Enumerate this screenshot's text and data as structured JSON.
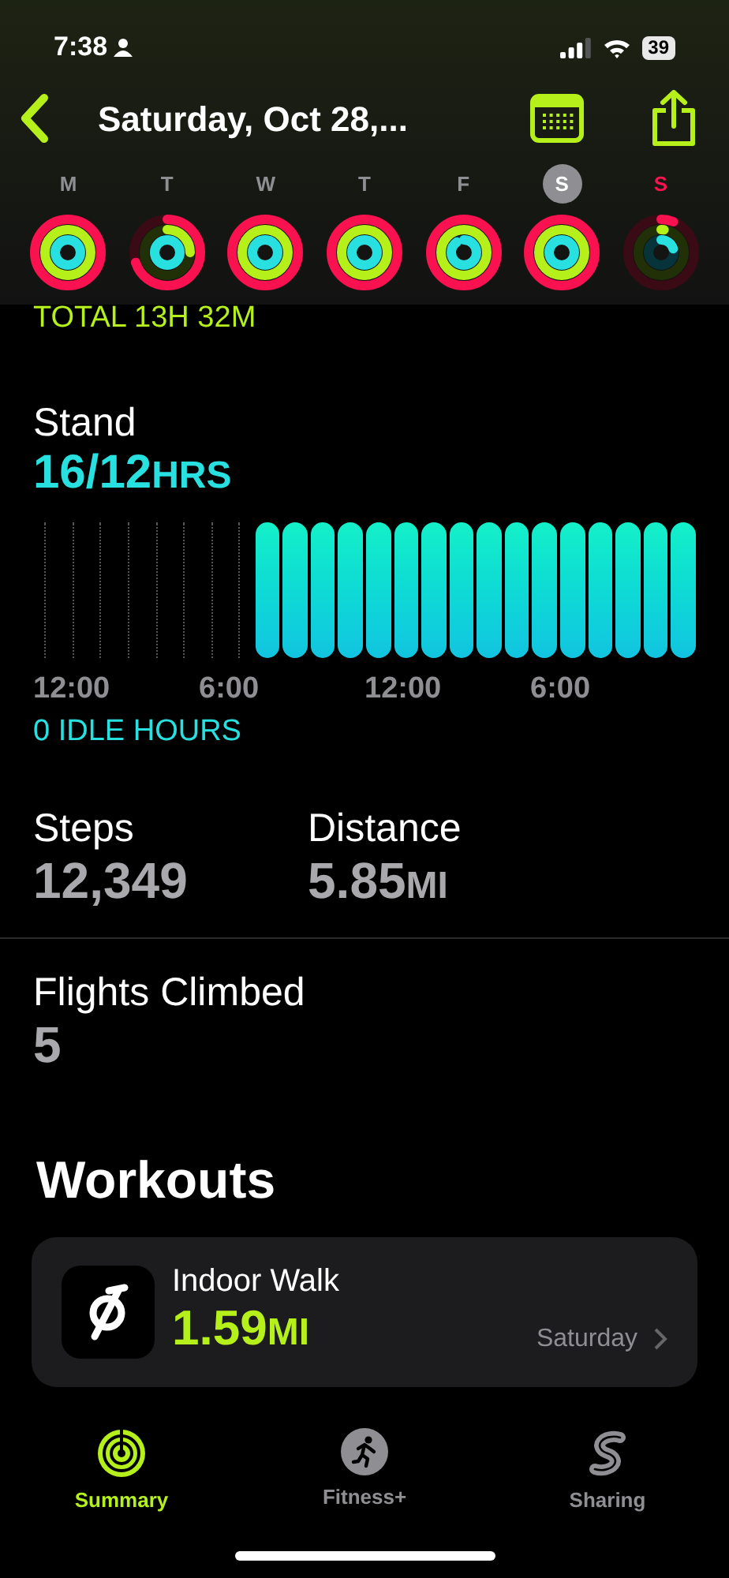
{
  "status_bar": {
    "time": "7:38",
    "battery": "39"
  },
  "nav": {
    "title": "Saturday, Oct 28,..."
  },
  "days": [
    {
      "label": "M",
      "selected": false,
      "today": false,
      "rings": [
        {
          "level": 1
        },
        {
          "level": 1
        },
        {
          "level": 1
        }
      ]
    },
    {
      "label": "T",
      "selected": false,
      "today": false,
      "rings": [
        {
          "level": 0.7
        },
        {
          "level": 0.25
        },
        {
          "level": 1
        }
      ]
    },
    {
      "label": "W",
      "selected": false,
      "today": false,
      "rings": [
        {
          "level": 1
        },
        {
          "level": 1
        },
        {
          "level": 1
        }
      ]
    },
    {
      "label": "T",
      "selected": false,
      "today": false,
      "rings": [
        {
          "level": 1
        },
        {
          "level": 1
        },
        {
          "level": 1
        }
      ]
    },
    {
      "label": "F",
      "selected": false,
      "today": false,
      "rings": [
        {
          "level": 1
        },
        {
          "level": 1
        },
        {
          "level": 0.9
        }
      ]
    },
    {
      "label": "S",
      "selected": true,
      "today": false,
      "rings": [
        {
          "level": 1
        },
        {
          "level": 1
        },
        {
          "level": 1
        }
      ]
    },
    {
      "label": "S",
      "selected": false,
      "today": true,
      "rings": [
        {
          "level": 0.06
        },
        {
          "level": 0.02
        },
        {
          "level": 0.2
        }
      ]
    }
  ],
  "total": "TOTAL 13H 32M",
  "stand": {
    "title": "Stand",
    "value": "16/12",
    "unit": "HRS",
    "hours": [
      {
        "stood": false
      },
      {
        "stood": false
      },
      {
        "stood": false
      },
      {
        "stood": false
      },
      {
        "stood": false
      },
      {
        "stood": false
      },
      {
        "stood": false
      },
      {
        "stood": false
      },
      {
        "stood": true
      },
      {
        "stood": true
      },
      {
        "stood": true
      },
      {
        "stood": true
      },
      {
        "stood": true
      },
      {
        "stood": true
      },
      {
        "stood": true
      },
      {
        "stood": true
      },
      {
        "stood": true
      },
      {
        "stood": true
      },
      {
        "stood": true
      },
      {
        "stood": true
      },
      {
        "stood": true
      },
      {
        "stood": true
      },
      {
        "stood": true
      },
      {
        "stood": true
      }
    ],
    "axis": [
      "12:00",
      "6:00",
      "12:00",
      "6:00"
    ],
    "idle": "0 IDLE HOURS"
  },
  "stats": [
    {
      "label": "Steps",
      "value": "12,349"
    },
    {
      "label": "Distance",
      "value": "5.85",
      "unit": "MI"
    }
  ],
  "flights": {
    "label": "Flights Climbed",
    "value": "5"
  },
  "workouts": {
    "title": "Workouts",
    "items": [
      {
        "name": "Indoor Walk",
        "value": "1.59",
        "unit": "MI",
        "day": "Saturday"
      }
    ]
  },
  "tabs": [
    {
      "label": "Summary",
      "selected": true
    },
    {
      "label": "Fitness+",
      "selected": false
    },
    {
      "label": "Sharing",
      "selected": false
    }
  ]
}
